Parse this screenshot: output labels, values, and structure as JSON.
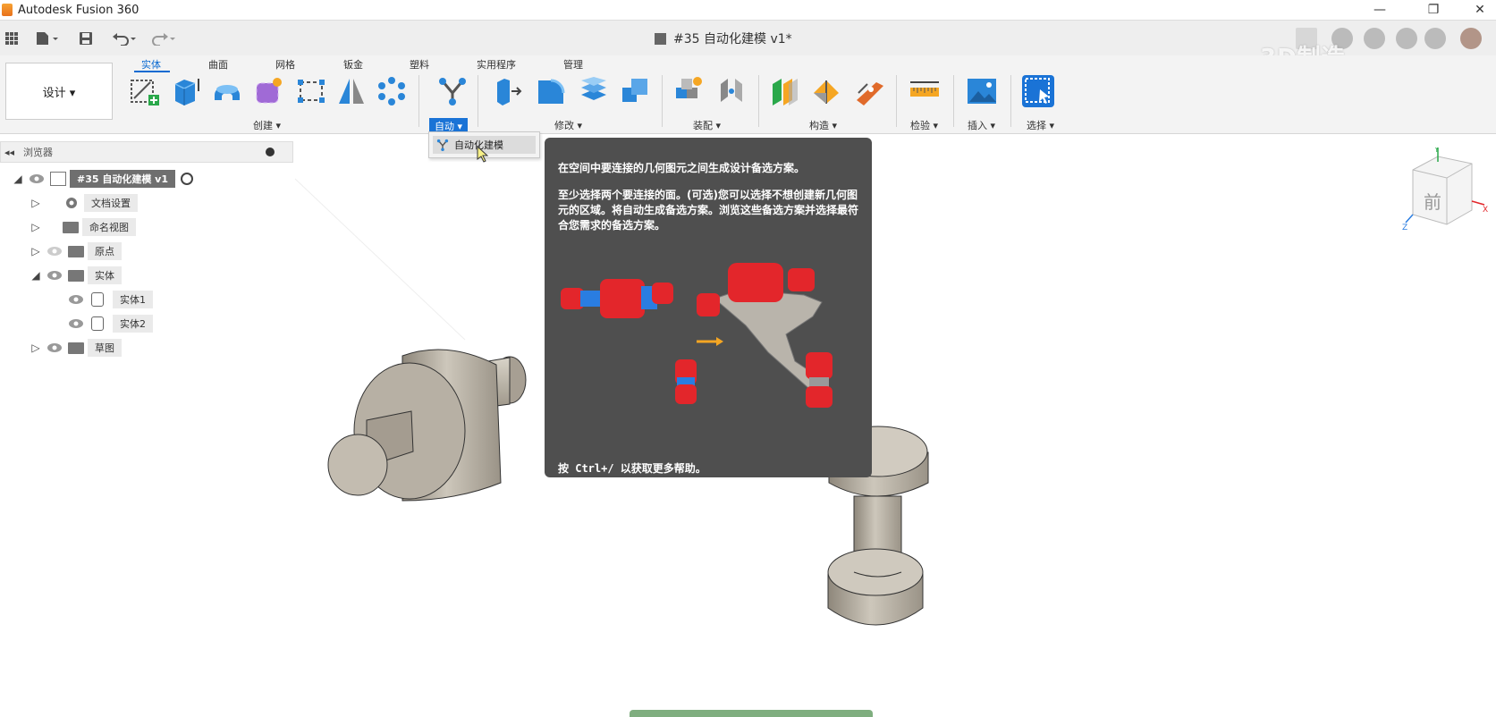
{
  "window": {
    "title": "Autodesk Fusion 360",
    "minimize_glyph": "—",
    "restore_glyph": "❐",
    "close_glyph": "✕"
  },
  "quick_access": {
    "grid_icon": "grid-icon",
    "file_icon": "file-icon",
    "save_icon": "save-icon",
    "undo_icon": "undo-icon",
    "redo_icon": "redo-icon"
  },
  "document": {
    "title": "#35  自动化建模 v1*"
  },
  "watermark": "3D制造",
  "ribbon": {
    "design_button": "设计 ▾",
    "tabs": [
      "实体",
      "曲面",
      "网格",
      "钣金",
      "塑料",
      "实用程序",
      "管理"
    ],
    "groups": {
      "create": "创建 ▾",
      "automate": "自动 ▾",
      "modify": "修改 ▾",
      "assemble": "装配 ▾",
      "construct": "构造 ▾",
      "inspect": "检验 ▾",
      "insert": "插入 ▾",
      "select": "选择 ▾"
    }
  },
  "dropdown": {
    "item": "自动化建模"
  },
  "browser": {
    "title": "浏览器",
    "collapse_glyph": "◂◂",
    "root": "#35  自动化建模 v1",
    "items": [
      "文档设置",
      "命名视图",
      "原点",
      "实体",
      "实体1",
      "实体2",
      "草图"
    ]
  },
  "tooltip": {
    "line1": "在空间中要连接的几何图元之间生成设计备选方案。",
    "line2": "至少选择两个要连接的面。(可选)您可以选择不想创建新几何图元的区域。将自动生成备选方案。浏览这些备选方案并选择最符合您需求的备选方案。",
    "line3": "按 Ctrl+/ 以获取更多帮助。"
  },
  "viewcube": {
    "face_label": "前",
    "axis_x": "X",
    "axis_y": "Y",
    "axis_z": "Z"
  },
  "colors": {
    "accent": "#1a73d6",
    "tooltip_bg": "#4f4f4f",
    "model_body": "#b8b2a6",
    "red_part": "#e3262b",
    "blue_part": "#2a7de1"
  }
}
